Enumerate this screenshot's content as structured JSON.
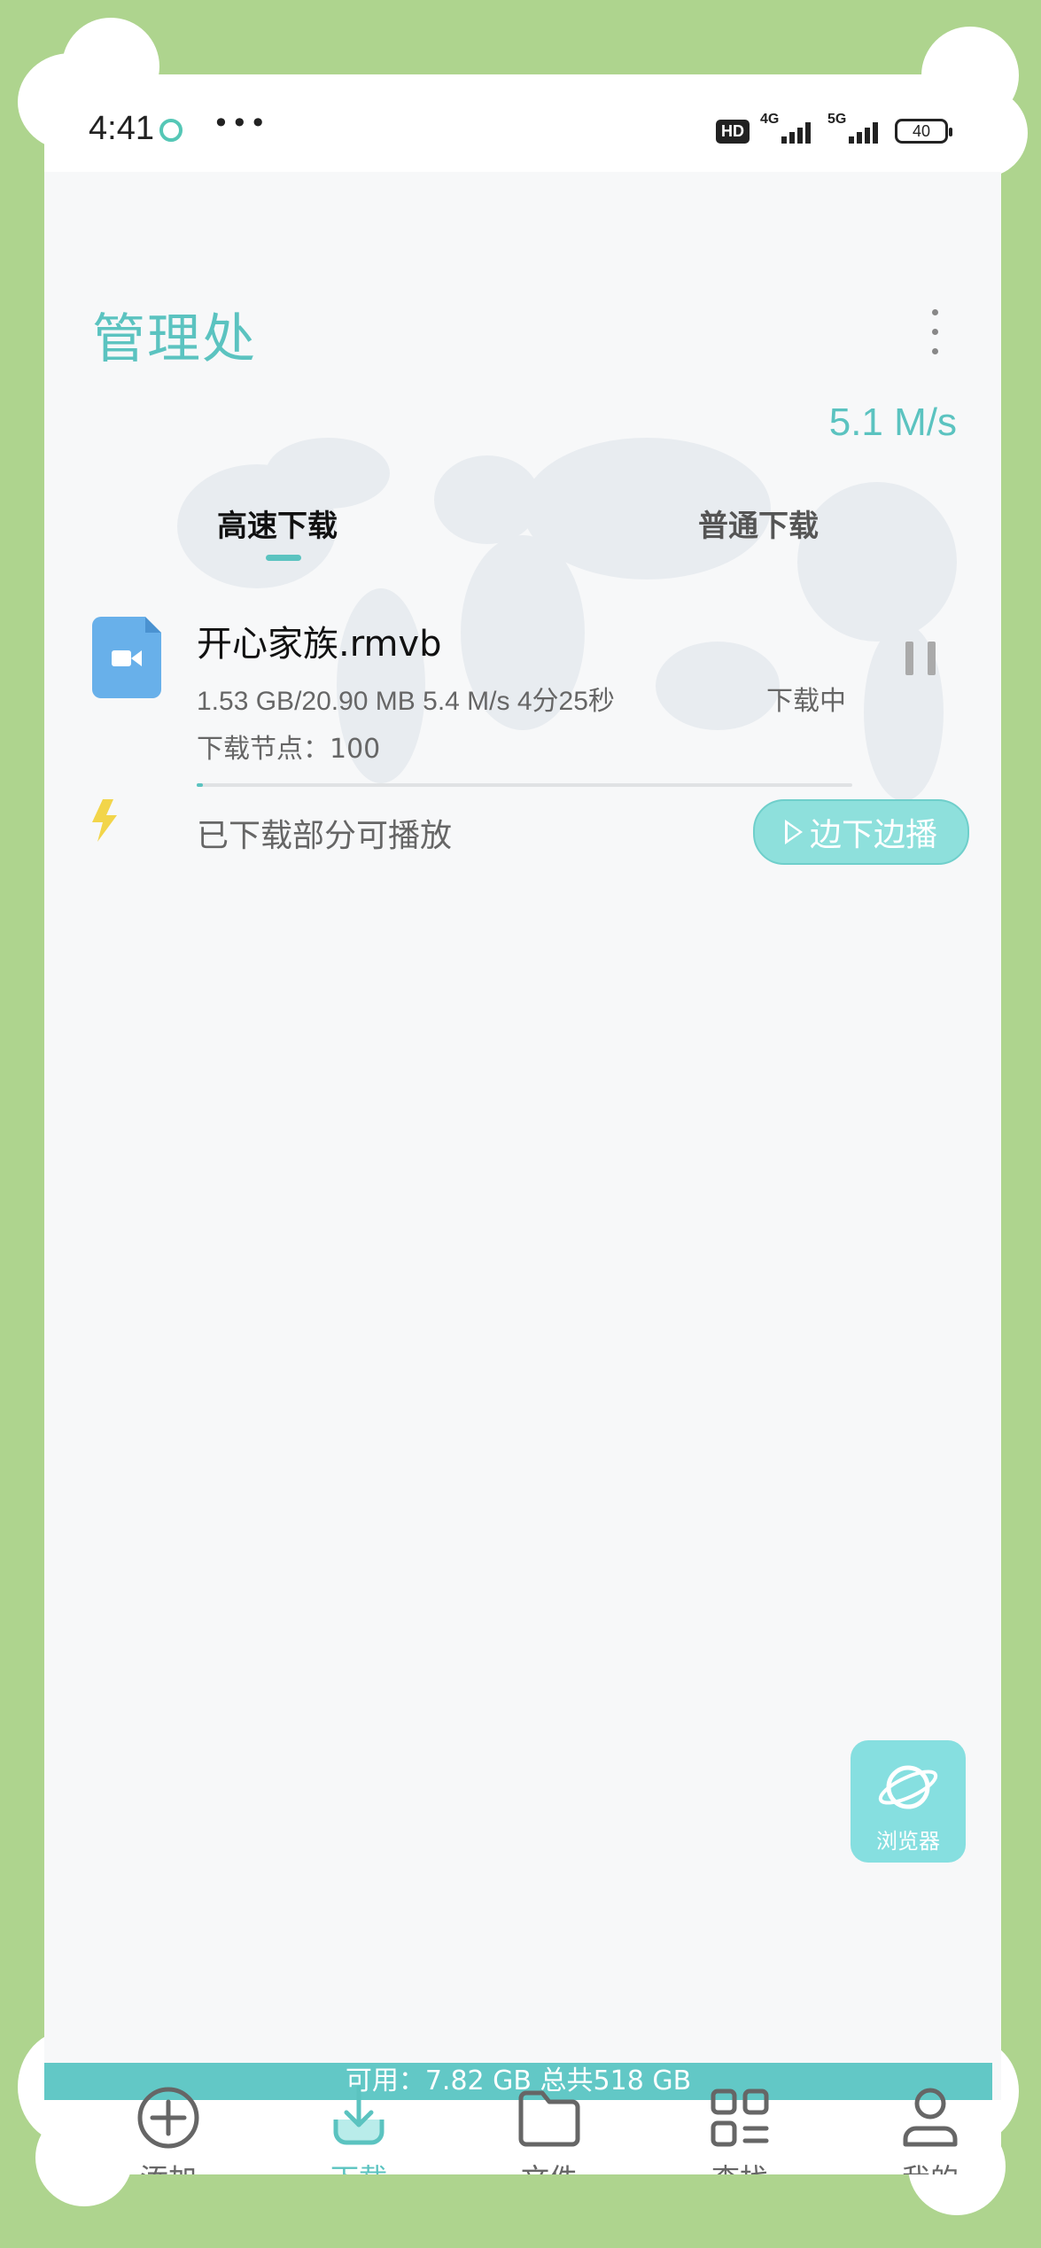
{
  "status_bar": {
    "time": "4:41",
    "hd_badge": "HD",
    "signal_1_label": "4G",
    "signal_2_label": "5G",
    "battery": "40"
  },
  "header": {
    "title": "管理处",
    "speed": "5.1 M/s"
  },
  "tabs": [
    {
      "label": "高速下载",
      "active": true
    },
    {
      "label": "普通下载",
      "active": false
    }
  ],
  "download": {
    "file_name": "开心家族.rmvb",
    "info": "1.53 GB/20.90 MB  5.4 M/s  4分25秒",
    "status": "下载中",
    "nodes": "下载节点：100",
    "progress_fraction": 0.01,
    "playable_text": "已下载部分可播放",
    "play_button": "边下边播"
  },
  "floating": {
    "browser_label": "浏览器"
  },
  "storage_text": "可用：7.82 GB 总共518 GB",
  "nav": [
    {
      "label": "添加",
      "icon": "add-icon"
    },
    {
      "label": "下载",
      "icon": "download-icon",
      "active": true
    },
    {
      "label": "文件",
      "icon": "folder-icon"
    },
    {
      "label": "查找",
      "icon": "apps-icon"
    },
    {
      "label": "我的",
      "icon": "user-icon"
    }
  ],
  "colors": {
    "accent": "#5bc3c0",
    "frame": "#aed48e",
    "file_icon": "#68b0ea",
    "bolt": "#f2d54a"
  }
}
